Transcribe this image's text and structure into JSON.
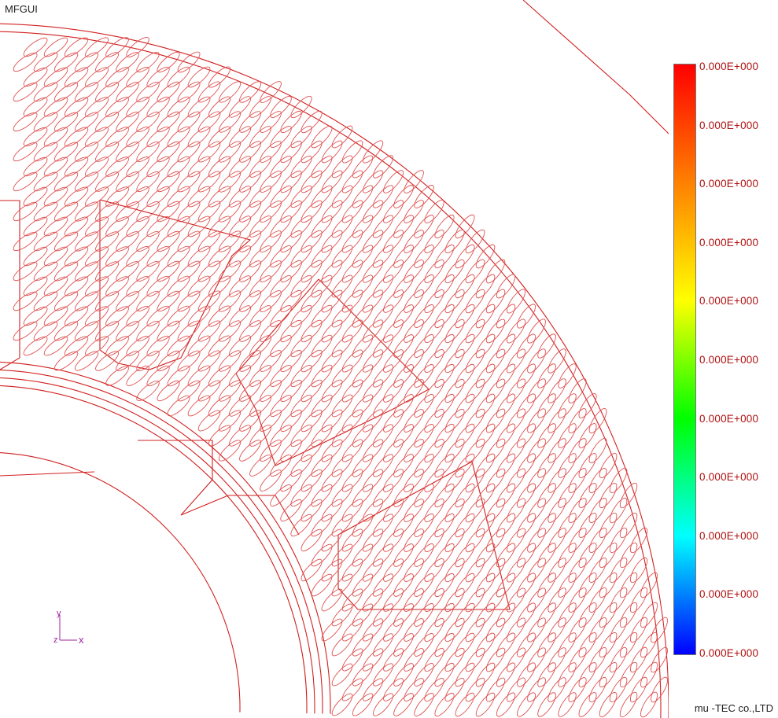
{
  "window": {
    "title": "MFGUI"
  },
  "footer": {
    "company": "mu -TEC co.,LTD"
  },
  "legend": {
    "labels": [
      "0.000E+000",
      "0.000E+000",
      "0.000E+000",
      "0.000E+000",
      "0.000E+000",
      "0.000E+000",
      "0.000E+000",
      "0.000E+000",
      "0.000E+000",
      "0.000E+000",
      "0.000E+000"
    ],
    "gradient_colors": [
      "#ff0000",
      "#ff8000",
      "#ffff00",
      "#00ff00",
      "#00ffff",
      "#0000ff"
    ]
  },
  "axis": {
    "y_label": "y",
    "z_label": "z",
    "x_label": "x",
    "color": "#a020a0"
  },
  "mesh": {
    "line_color": "#d22020"
  }
}
